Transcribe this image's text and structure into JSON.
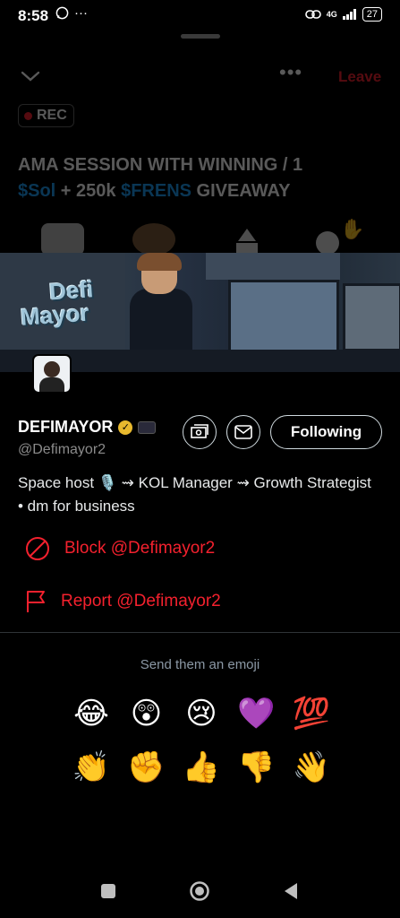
{
  "status_bar": {
    "time": "8:58",
    "left_icons": [
      "whatsapp-icon",
      "more-icon"
    ],
    "network": "4G",
    "battery": "27"
  },
  "space": {
    "leave_label": "Leave",
    "rec_label": "REC",
    "title_part1": "AMA SESSION WITH WINNING / 1",
    "title_cash1": "$Sol",
    "title_mid": " + 250k ",
    "title_cash2": "$FRENS",
    "title_end": " GIVEAWAY",
    "speaker_raised_hand": "✋"
  },
  "profile": {
    "banner_logo_line1": "Defi",
    "banner_logo_line2": "Mayor",
    "display_name": "DEFIMAYOR",
    "handle": "@Defimayor2",
    "following_label": "Following",
    "bio": "Space host 🎙️ ⇝ KOL Manager ⇝ Growth Strategist • dm for business",
    "block_label": "Block @Defimayor2",
    "report_label": "Report @Defimayor2"
  },
  "emoji_section": {
    "title": "Send them an emoji",
    "row1": [
      "😂",
      "😲",
      "😢",
      "💜",
      "💯"
    ],
    "row2": [
      "👏",
      "✊",
      "👍",
      "👎",
      "👋"
    ]
  },
  "colors": {
    "accent_red": "#f4212e",
    "cashtag_blue": "#1d9bf0",
    "verified_gold": "#e8b92e"
  }
}
